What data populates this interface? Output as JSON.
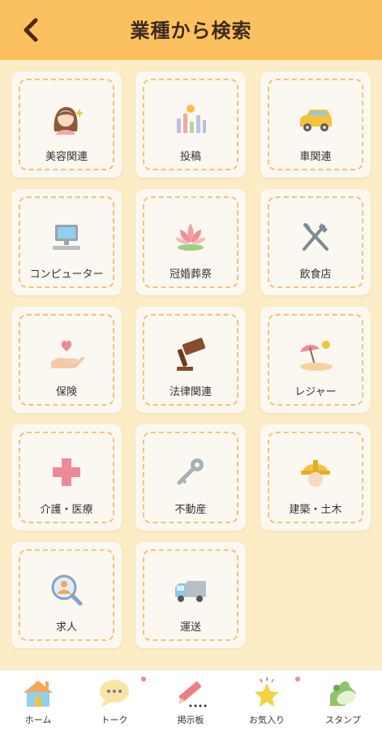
{
  "header": {
    "title": "業種から検索",
    "back_icon": "chevron-left-icon"
  },
  "colors": {
    "header": "#fcc15f",
    "background": "#fdedc7",
    "tile_border": "#f3c27a",
    "badge": "#f08a96"
  },
  "categories": [
    {
      "label": "美容関連",
      "icon": "beauty-woman-icon"
    },
    {
      "label": "投稿",
      "icon": "chart-bars-icon"
    },
    {
      "label": "車関連",
      "icon": "car-icon"
    },
    {
      "label": "コンピューター",
      "icon": "computer-icon"
    },
    {
      "label": "冠婚葬祭",
      "icon": "lotus-icon"
    },
    {
      "label": "飲食店",
      "icon": "fork-knife-icon"
    },
    {
      "label": "保険",
      "icon": "heart-hand-icon"
    },
    {
      "label": "法律関連",
      "icon": "gavel-icon"
    },
    {
      "label": "レジャー",
      "icon": "beach-umbrella-icon"
    },
    {
      "label": "介護・医療",
      "icon": "medical-cross-icon"
    },
    {
      "label": "不動産",
      "icon": "key-icon"
    },
    {
      "label": "建築・土木",
      "icon": "hard-hat-icon"
    },
    {
      "label": "求人",
      "icon": "magnifier-person-icon"
    },
    {
      "label": "運送",
      "icon": "truck-icon"
    }
  ],
  "tabbar": [
    {
      "label": "ホーム",
      "icon": "house-icon",
      "badge": false
    },
    {
      "label": "トーク",
      "icon": "chat-bubble-icon",
      "badge": true
    },
    {
      "label": "掲示板",
      "icon": "pencil-icon",
      "badge": false
    },
    {
      "label": "お気入り",
      "icon": "star-icon",
      "badge": true
    },
    {
      "label": "スタンプ",
      "icon": "stamp-icon",
      "badge": false
    }
  ]
}
